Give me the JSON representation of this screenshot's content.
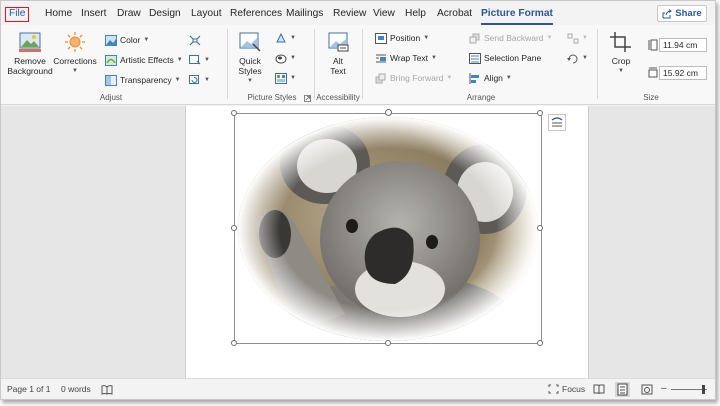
{
  "tabs": [
    {
      "label": "File"
    },
    {
      "label": "Home"
    },
    {
      "label": "Insert"
    },
    {
      "label": "Draw"
    },
    {
      "label": "Design"
    },
    {
      "label": "Layout"
    },
    {
      "label": "References"
    },
    {
      "label": "Mailings"
    },
    {
      "label": "Review"
    },
    {
      "label": "View"
    },
    {
      "label": "Help"
    },
    {
      "label": "Acrobat"
    },
    {
      "label": "Picture Format"
    }
  ],
  "share": {
    "label": "Share"
  },
  "ribbon": {
    "adjust": {
      "group_label": "Adjust",
      "remove_background": "Remove\nBackground",
      "corrections": "Corrections",
      "color": "Color",
      "artistic_effects": "Artistic Effects",
      "transparency": "Transparency"
    },
    "picture_styles": {
      "group_label": "Picture Styles",
      "quick_styles": "Quick\nStyles"
    },
    "accessibility": {
      "group_label": "Accessibility",
      "alt_text": "Alt\nText"
    },
    "arrange": {
      "group_label": "Arrange",
      "position": "Position",
      "wrap_text": "Wrap Text",
      "bring_forward": "Bring Forward",
      "send_backward": "Send Backward",
      "selection_pane": "Selection Pane",
      "align": "Align"
    },
    "size": {
      "group_label": "Size",
      "crop": "Crop",
      "height": "11.94 cm",
      "width": "15.92 cm"
    }
  },
  "status": {
    "page": "Page 1 of 1",
    "words": "0 words",
    "focus": "Focus"
  },
  "colors": {
    "accent": "#2b579a",
    "file_outline": "#e81123"
  }
}
